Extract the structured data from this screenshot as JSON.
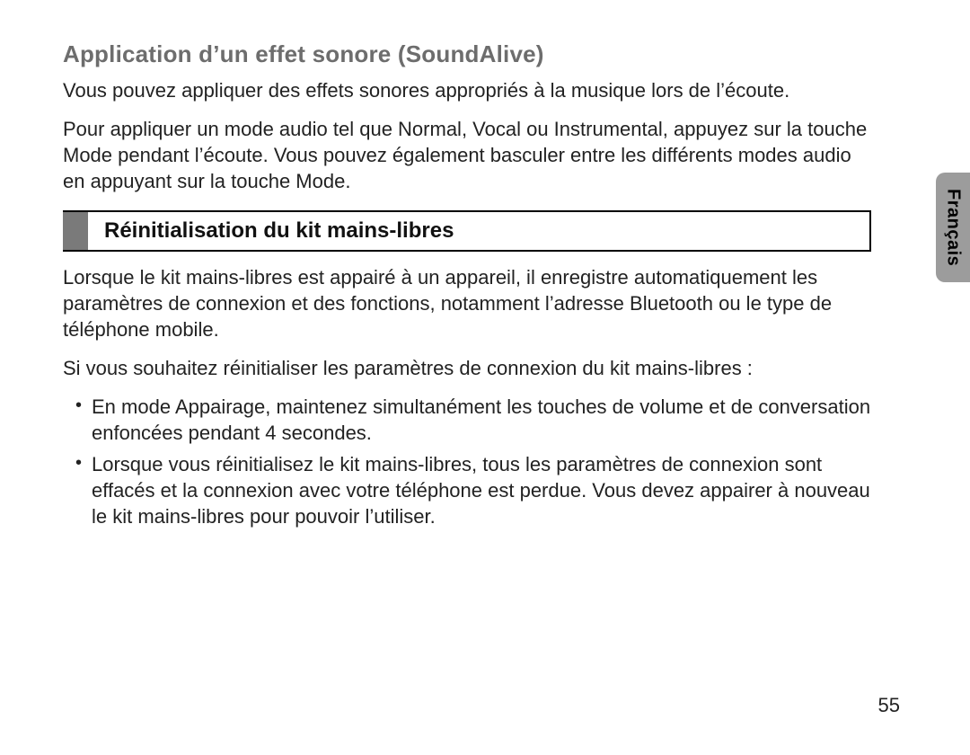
{
  "section1": {
    "heading": "Application d’un effet sonore (SoundAlive)",
    "para1": "Vous pouvez appliquer des effets sonores appropriés à la musique lors de l’écoute.",
    "para2": "Pour appliquer un mode audio tel que Normal, Vocal ou Instrumental, appuyez sur la touche Mode pendant l’écoute. Vous pouvez également basculer entre les différents modes audio en appuyant sur la touche Mode."
  },
  "section2": {
    "heading": "Réinitialisation du kit mains-libres",
    "para1": "Lorsque le kit mains-libres est appairé à un appareil, il enregistre automatiquement les paramètres de connexion et des fonctions, notamment l’adresse Bluetooth ou le type de téléphone mobile.",
    "para2": "Si vous souhaitez réinitialiser les paramètres de connexion du kit mains-libres :",
    "bullets": [
      "En mode Appairage, maintenez simultanément les touches de volume et de conversation enfoncées pendant 4 secondes.",
      "Lorsque vous réinitialisez le kit mains-libres, tous les paramètres de connexion sont effacés et la connexion avec votre téléphone est perdue. Vous devez appairer à nouveau le kit mains-libres pour pouvoir l’utiliser."
    ]
  },
  "sideTab": "Français",
  "pageNumber": "55"
}
